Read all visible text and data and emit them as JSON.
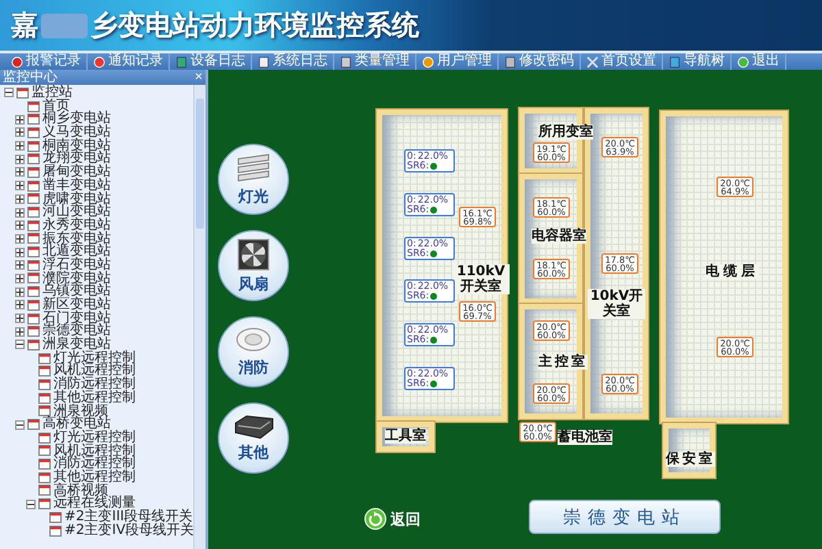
{
  "header": {
    "title_start": "嘉",
    "title_end": "乡变电站动力环境监控系统"
  },
  "toolbar": [
    {
      "label": "报警记录"
    },
    {
      "label": "通知记录"
    },
    {
      "label": "设备日志"
    },
    {
      "label": "系统日志"
    },
    {
      "label": "类量管理"
    },
    {
      "label": "用户管理"
    },
    {
      "label": "修改密码"
    },
    {
      "label": "首页设置"
    },
    {
      "label": "导航树"
    },
    {
      "label": "退出"
    }
  ],
  "sidebar": {
    "title": "监控中心",
    "close": "×",
    "tree": [
      {
        "label": "监控站",
        "expanded": true,
        "children": [
          {
            "label": "首页"
          },
          {
            "label": "桐乡变电站",
            "expanded": false
          },
          {
            "label": "义马变电站",
            "expanded": false
          },
          {
            "label": "桐南变电站",
            "expanded": false
          },
          {
            "label": "龙翔变电站",
            "expanded": false
          },
          {
            "label": "屠甸变电站",
            "expanded": false
          },
          {
            "label": "凿丰变电站",
            "expanded": false
          },
          {
            "label": "虎啸变电站",
            "expanded": false
          },
          {
            "label": "河山变电站",
            "expanded": false
          },
          {
            "label": "永秀变电站",
            "expanded": false
          },
          {
            "label": "振东变电站",
            "expanded": false
          },
          {
            "label": "北遁变电站",
            "expanded": false
          },
          {
            "label": "浮石变电站",
            "expanded": false
          },
          {
            "label": "濮院变电站",
            "expanded": false
          },
          {
            "label": "乌镇变电站",
            "expanded": false
          },
          {
            "label": "新区变电站",
            "expanded": false
          },
          {
            "label": "石门变电站",
            "expanded": false
          },
          {
            "label": "崇德变电站",
            "expanded": false
          },
          {
            "label": "洲泉变电站",
            "expanded": true,
            "children": [
              {
                "label": "灯光远程控制"
              },
              {
                "label": "风机远程控制"
              },
              {
                "label": "消防远程控制"
              },
              {
                "label": "其他远程控制"
              },
              {
                "label": "洲泉视频"
              }
            ]
          },
          {
            "label": "高桥变电站",
            "expanded": true,
            "children": [
              {
                "label": "灯光远程控制"
              },
              {
                "label": "风机远程控制"
              },
              {
                "label": "消防远程控制"
              },
              {
                "label": "其他远程控制"
              },
              {
                "label": "高桥视频"
              },
              {
                "label": "远程在线测量",
                "expanded": true,
                "children": [
                  {
                    "label": "#2主变III段母线开关"
                  },
                  {
                    "label": "#2主变IV段母线开关"
                  }
                ]
              }
            ]
          }
        ]
      }
    ]
  },
  "categories": [
    {
      "label": "灯光",
      "kind": "light"
    },
    {
      "label": "风扇",
      "kind": "fan"
    },
    {
      "label": "消防",
      "kind": "fire"
    },
    {
      "label": "其他",
      "kind": "other"
    }
  ],
  "rooms": [
    {
      "label": "110kV开关室"
    },
    {
      "label": "工具室"
    },
    {
      "label": "所用变室"
    },
    {
      "label": "电容器室"
    },
    {
      "label": "主控室"
    },
    {
      "label": "10kV开关室"
    },
    {
      "label": "蓄电池室"
    },
    {
      "label": "电缆层"
    },
    {
      "label": "保安室"
    }
  ],
  "ac_units": [
    {
      "mode": "0:",
      "setting": "22.0%",
      "status_label": "SR6:",
      "on": true
    },
    {
      "mode": "0:",
      "setting": "22.0%",
      "status_label": "SR6:",
      "on": true
    },
    {
      "mode": "0:",
      "setting": "22.0%",
      "status_label": "SR6:",
      "on": true
    },
    {
      "mode": "0:",
      "setting": "22.0%",
      "status_label": "SR6:",
      "on": true
    },
    {
      "mode": "0:",
      "setting": "22.0%",
      "status_label": "SR6:",
      "on": true
    },
    {
      "mode": "0:",
      "setting": "22.0%",
      "status_label": "SR6:",
      "on": true
    }
  ],
  "sensors": [
    {
      "temperature": "16.1℃",
      "humidity": "69.8%"
    },
    {
      "temperature": "16.0℃",
      "humidity": "69.7%"
    },
    {
      "temperature": "19.1℃",
      "humidity": "60.0%"
    },
    {
      "temperature": "18.1℃",
      "humidity": "60.0%"
    },
    {
      "temperature": "18.1℃",
      "humidity": "60.0%"
    },
    {
      "temperature": "20.0℃",
      "humidity": "60.0%"
    },
    {
      "temperature": "20.0℃",
      "humidity": "60.0%"
    },
    {
      "temperature": "20.0℃",
      "humidity": "63.9%"
    },
    {
      "temperature": "17.8℃",
      "humidity": "60.0%"
    },
    {
      "temperature": "20.0℃",
      "humidity": "60.0%"
    },
    {
      "temperature": "20.0℃",
      "humidity": "60.0%"
    },
    {
      "temperature": "20.0℃",
      "humidity": "64.9%"
    },
    {
      "temperature": "20.0℃",
      "humidity": "60.0%"
    }
  ],
  "back_button": "返回",
  "station_button": "崇德变电站"
}
